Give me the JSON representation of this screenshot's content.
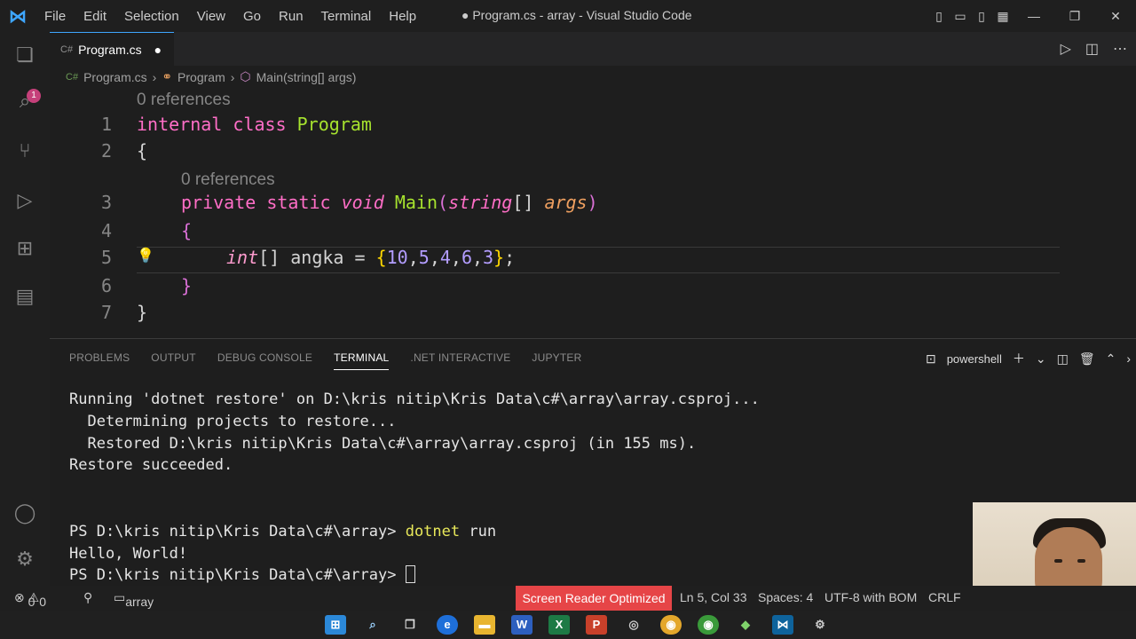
{
  "titlebar": {
    "menu": [
      "File",
      "Edit",
      "Selection",
      "View",
      "Go",
      "Run",
      "Terminal",
      "Help"
    ],
    "title": "● Program.cs - array - Visual Studio Code"
  },
  "activity": {
    "badge": "1"
  },
  "tab": {
    "filetype": "C#",
    "label": "Program.cs",
    "modified": "●"
  },
  "breadcrumb": {
    "file": "Program.cs",
    "class": "Program",
    "method": "Main(string[] args)",
    "sep": "›"
  },
  "editor": {
    "lens1": "0 references",
    "lens2": "0 references",
    "lines": {
      "n1": "1",
      "n2": "2",
      "n3": "3",
      "n4": "4",
      "n5": "5",
      "n6": "6",
      "n7": "7",
      "l1_kw": "internal class ",
      "l1_ty": "Program",
      "l2": "{",
      "l3_kw": "private static ",
      "l3_void": "void ",
      "l3_main": "Main",
      "l3_p1": "(",
      "l3_string": "string",
      "l3_arr": "[] ",
      "l3_args": "args",
      "l3_p2": ")",
      "l4": "{",
      "l5_int": "int",
      "l5_rest": "[] angka = ",
      "l5_ob": "{",
      "l5_nums": [
        "10",
        "5",
        "4",
        "6",
        "3"
      ],
      "l5_cb": "}",
      "l5_end": ";",
      "l6": "}",
      "l7": "}"
    }
  },
  "panel": {
    "tabs": [
      "PROBLEMS",
      "OUTPUT",
      "DEBUG CONSOLE",
      "TERMINAL",
      ".NET INTERACTIVE",
      "JUPYTER"
    ],
    "active_tab": "TERMINAL",
    "shell": "powershell",
    "terminal": {
      "t1": "Running 'dotnet restore' on D:\\kris nitip\\Kris Data\\c#\\array\\array.csproj...",
      "t2": "  Determining projects to restore...",
      "t3": "  Restored D:\\kris nitip\\Kris Data\\c#\\array\\array.csproj (in 155 ms).",
      "t4": "Restore succeeded.",
      "prompt1": "PS D:\\kris nitip\\Kris Data\\c#\\array> ",
      "cmd1": "dotnet",
      "cmd1_rest": " run",
      "t6": "Hello, World!",
      "prompt2": "PS D:\\kris nitip\\Kris Data\\c#\\array> "
    }
  },
  "statusbar": {
    "errors": "0",
    "warnings": "0",
    "folder": "array",
    "screen_reader": "Screen Reader Optimized",
    "position": "Ln 5, Col 33",
    "spaces": "Spaces: 4",
    "encoding": "UTF-8 with BOM",
    "eol": "CRLF"
  },
  "colors": {
    "accent": "#3ea6ff",
    "keyword": "#ff6ec7",
    "type": "#a6e22e",
    "screen_reader_bg": "#e64547"
  }
}
